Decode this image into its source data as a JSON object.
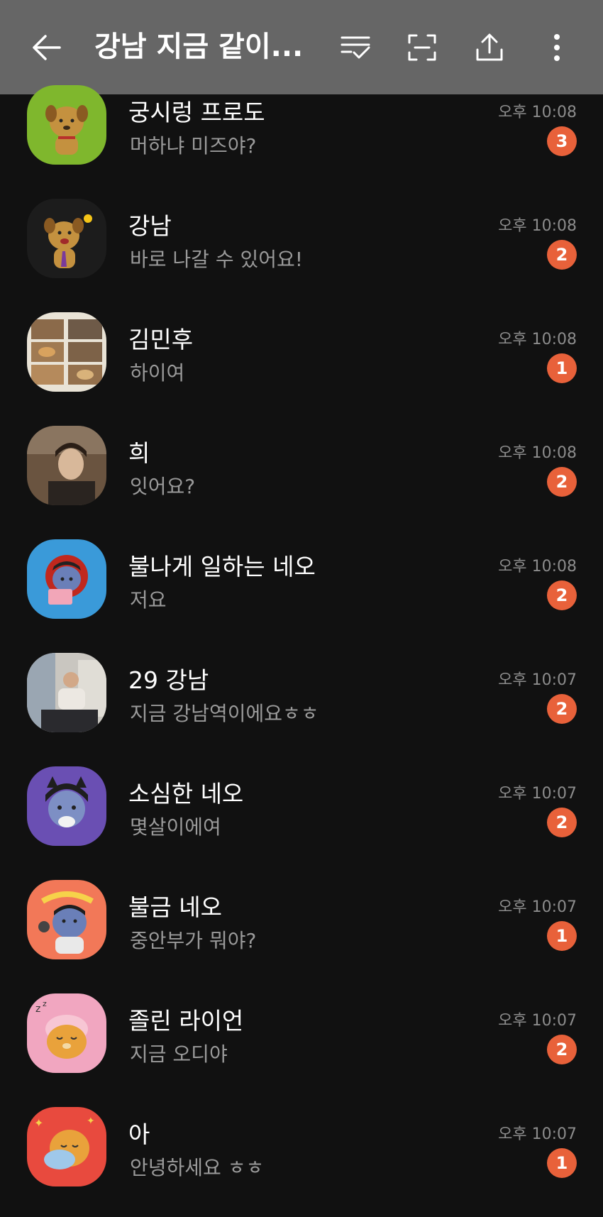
{
  "header": {
    "title": "강남 지금 같이...",
    "back_icon": "arrow-left-icon",
    "filter_icon": "read-filter-icon",
    "screenshot_icon": "capture-frame-icon",
    "share_icon": "share-upload-icon",
    "more_icon": "more-vertical-icon"
  },
  "colors": {
    "header_bg": "#666666",
    "background": "#111111",
    "badge": "#e8613a"
  },
  "chats": [
    {
      "name": "궁시렁 프로도",
      "preview": "머하냐 미즈야?",
      "time": "오후 10:08",
      "unread": "3",
      "avatar": "frodo-dog-green"
    },
    {
      "name": "강남",
      "preview": "바로 나갈 수 있어요!",
      "time": "오후 10:08",
      "unread": "2",
      "avatar": "frodo-dog-black"
    },
    {
      "name": "김민후",
      "preview": "하이여",
      "time": "오후 10:08",
      "unread": "1",
      "avatar": "food-photo"
    },
    {
      "name": "희",
      "preview": "잇어요?",
      "time": "오후 10:08",
      "unread": "2",
      "avatar": "person-photo"
    },
    {
      "name": "불나게 일하는 네오",
      "preview": "저요",
      "time": "오후 10:08",
      "unread": "2",
      "avatar": "neo-cat-blue"
    },
    {
      "name": "29 강남",
      "preview": "지금 강남역이에요ㅎㅎ",
      "time": "오후 10:07",
      "unread": "2",
      "avatar": "person-sitting-photo"
    },
    {
      "name": "소심한 네오",
      "preview": "몇살이에여",
      "time": "오후 10:07",
      "unread": "2",
      "avatar": "neo-cat-purple"
    },
    {
      "name": "불금 네오",
      "preview": "중안부가 뭐야?",
      "time": "오후 10:07",
      "unread": "1",
      "avatar": "neo-friday-orange"
    },
    {
      "name": "졸린 라이언",
      "preview": "지금 오디야",
      "time": "오후 10:07",
      "unread": "2",
      "avatar": "ryan-sleepy-pink"
    },
    {
      "name": "아",
      "preview": "안녕하세요 ㅎㅎ",
      "time": "오후 10:07",
      "unread": "1",
      "avatar": "ryan-hug-red"
    }
  ]
}
